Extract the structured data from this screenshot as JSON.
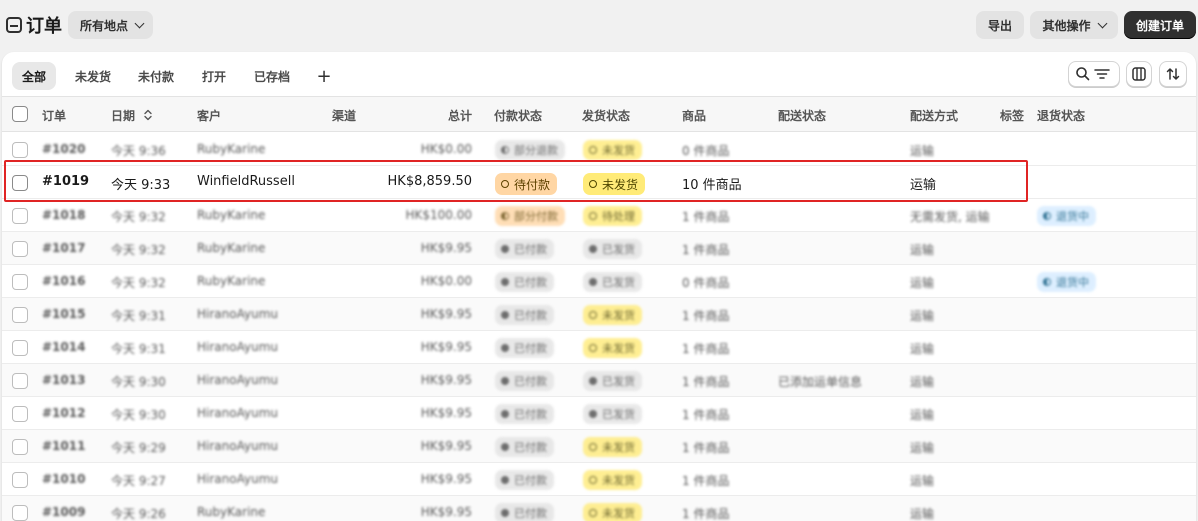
{
  "header": {
    "title": "订单",
    "location_filter": "所有地点",
    "export_label": "导出",
    "more_actions_label": "其他操作",
    "create_order_label": "创建订单"
  },
  "tabs": [
    {
      "label": "全部",
      "active": true
    },
    {
      "label": "未发货"
    },
    {
      "label": "未付款"
    },
    {
      "label": "打开"
    },
    {
      "label": "已存档"
    }
  ],
  "add_view_label": "+",
  "columns": {
    "order": "订单",
    "date": "日期",
    "customer": "客户",
    "channel": "渠道",
    "total": "总计",
    "payment_status": "付款状态",
    "fulfillment_status": "发货状态",
    "items": "商品",
    "delivery_status": "配送状态",
    "delivery_method": "配送方式",
    "tags": "标签",
    "return_status": "退货状态"
  },
  "colors": {
    "badge_gray_bg": "#e3e3e3",
    "badge_yellow_bg": "#ffeb78",
    "badge_orange_bg": "#ffd6a4",
    "badge_blue_bg": "#d5ebff",
    "highlight": "#e02424"
  },
  "orders": [
    {
      "order": "#1020",
      "date": "今天 9:36",
      "customer": "RubyKarine",
      "total": "HK$0.00",
      "payment": {
        "label": "部分退款",
        "style": "gray",
        "dot": "half"
      },
      "fulfillment": {
        "label": "未发货",
        "style": "yellow",
        "dot": "ring"
      },
      "items": "0 件商品",
      "delivery_status": "",
      "delivery_method": "运输",
      "return": null
    },
    {
      "order": "#1019",
      "date": "今天 9:33",
      "customer": "WinfieldRussell",
      "total": "HK$8,859.50",
      "payment": {
        "label": "待付款",
        "style": "orange",
        "dot": "ring"
      },
      "fulfillment": {
        "label": "未发货",
        "style": "yellow",
        "dot": "ring"
      },
      "items": "10 件商品",
      "delivery_status": "",
      "delivery_method": "运输",
      "return": null
    },
    {
      "order": "#1018",
      "date": "今天 9:32",
      "customer": "RubyKarine",
      "total": "HK$100.00",
      "payment": {
        "label": "部分付款",
        "style": "orange",
        "dot": "half"
      },
      "fulfillment": {
        "label": "待处理",
        "style": "yellow",
        "dot": "ring"
      },
      "items": "1 件商品",
      "delivery_status": "",
      "delivery_method": "无需发货, 运输",
      "return": {
        "label": "退货中",
        "style": "blue",
        "dot": "half"
      }
    },
    {
      "order": "#1017",
      "date": "今天 9:32",
      "customer": "RubyKarine",
      "total": "HK$9.95",
      "payment": {
        "label": "已付款",
        "style": "gray",
        "dot": "solid"
      },
      "fulfillment": {
        "label": "已发货",
        "style": "gray",
        "dot": "solid"
      },
      "items": "1 件商品",
      "delivery_status": "",
      "delivery_method": "运输",
      "return": null
    },
    {
      "order": "#1016",
      "date": "今天 9:32",
      "customer": "RubyKarine",
      "total": "HK$0.00",
      "payment": {
        "label": "已付款",
        "style": "gray",
        "dot": "solid"
      },
      "fulfillment": {
        "label": "已发货",
        "style": "gray",
        "dot": "solid"
      },
      "items": "0 件商品",
      "delivery_status": "",
      "delivery_method": "运输",
      "return": {
        "label": "退货中",
        "style": "blue",
        "dot": "half"
      }
    },
    {
      "order": "#1015",
      "date": "今天 9:31",
      "customer": "HiranoAyumu",
      "total": "HK$9.95",
      "payment": {
        "label": "已付款",
        "style": "gray",
        "dot": "solid"
      },
      "fulfillment": {
        "label": "未发货",
        "style": "yellow",
        "dot": "ring"
      },
      "items": "1 件商品",
      "delivery_status": "",
      "delivery_method": "运输",
      "return": null
    },
    {
      "order": "#1014",
      "date": "今天 9:31",
      "customer": "HiranoAyumu",
      "total": "HK$9.95",
      "payment": {
        "label": "已付款",
        "style": "gray",
        "dot": "solid"
      },
      "fulfillment": {
        "label": "未发货",
        "style": "yellow",
        "dot": "ring"
      },
      "items": "1 件商品",
      "delivery_status": "",
      "delivery_method": "运输",
      "return": null
    },
    {
      "order": "#1013",
      "date": "今天 9:30",
      "customer": "HiranoAyumu",
      "total": "HK$9.95",
      "payment": {
        "label": "已付款",
        "style": "gray",
        "dot": "solid"
      },
      "fulfillment": {
        "label": "已发货",
        "style": "gray",
        "dot": "solid"
      },
      "items": "1 件商品",
      "delivery_status": "已添加运单信息",
      "delivery_method": "运输",
      "return": null
    },
    {
      "order": "#1012",
      "date": "今天 9:30",
      "customer": "HiranoAyumu",
      "total": "HK$9.95",
      "payment": {
        "label": "已付款",
        "style": "gray",
        "dot": "solid"
      },
      "fulfillment": {
        "label": "已发货",
        "style": "gray",
        "dot": "solid"
      },
      "items": "1 件商品",
      "delivery_status": "",
      "delivery_method": "运输",
      "return": null
    },
    {
      "order": "#1011",
      "date": "今天 9:29",
      "customer": "HiranoAyumu",
      "total": "HK$9.95",
      "payment": {
        "label": "已付款",
        "style": "gray",
        "dot": "solid"
      },
      "fulfillment": {
        "label": "未发货",
        "style": "yellow",
        "dot": "ring"
      },
      "items": "1 件商品",
      "delivery_status": "",
      "delivery_method": "运输",
      "return": null
    },
    {
      "order": "#1010",
      "date": "今天 9:27",
      "customer": "HiranoAyumu",
      "total": "HK$9.95",
      "payment": {
        "label": "已付款",
        "style": "gray",
        "dot": "solid"
      },
      "fulfillment": {
        "label": "未发货",
        "style": "yellow",
        "dot": "ring"
      },
      "items": "1 件商品",
      "delivery_status": "",
      "delivery_method": "运输",
      "return": null
    },
    {
      "order": "#1009",
      "date": "今天 9:26",
      "customer": "RubyKarine",
      "total": "HK$9.95",
      "payment": {
        "label": "已付款",
        "style": "gray",
        "dot": "solid"
      },
      "fulfillment": {
        "label": "未发货",
        "style": "yellow",
        "dot": "ring"
      },
      "items": "1 件商品",
      "delivery_status": "",
      "delivery_method": "运输",
      "return": null
    }
  ]
}
